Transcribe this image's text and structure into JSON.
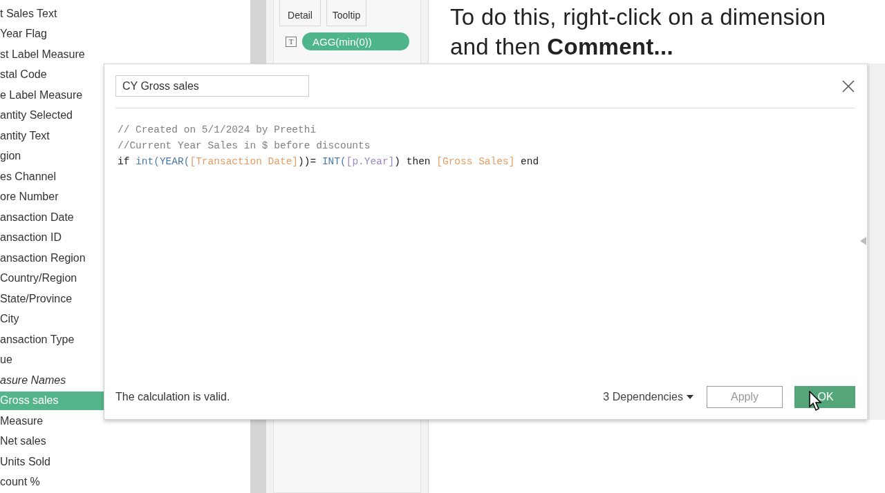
{
  "fields": [
    {
      "label": "t Sales Text",
      "kind": "field",
      "selected": false
    },
    {
      "label": "Year Flag",
      "kind": "field",
      "selected": false
    },
    {
      "label": "st Label Measure",
      "kind": "field",
      "selected": false
    },
    {
      "label": "stal Code",
      "kind": "field",
      "selected": false
    },
    {
      "label": "e Label Measure",
      "kind": "field",
      "selected": false
    },
    {
      "label": "antity  Selected",
      "kind": "field",
      "selected": false
    },
    {
      "label": "antity Text",
      "kind": "field",
      "selected": false
    },
    {
      "label": "gion",
      "kind": "field",
      "selected": false
    },
    {
      "label": "es Channel",
      "kind": "field",
      "selected": false
    },
    {
      "label": "ore Number",
      "kind": "field",
      "selected": false
    },
    {
      "label": "ansaction Date",
      "kind": "field",
      "selected": false
    },
    {
      "label": "ansaction ID",
      "kind": "field",
      "selected": false
    },
    {
      "label": "ansaction Region",
      "kind": "field",
      "selected": false
    },
    {
      "label": "Country/Region",
      "kind": "field",
      "selected": false
    },
    {
      "label": "State/Province",
      "kind": "field",
      "selected": false
    },
    {
      "label": "City",
      "kind": "field",
      "selected": false
    },
    {
      "label": "ansaction Type",
      "kind": "field",
      "selected": false
    },
    {
      "label": "ue",
      "kind": "field",
      "selected": false
    },
    {
      "label": "asure Names",
      "kind": "generated",
      "selected": false
    },
    {
      "label": "Gross sales",
      "kind": "field",
      "selected": true
    },
    {
      "label": "Measure",
      "kind": "field",
      "selected": false
    },
    {
      "label": "Net sales",
      "kind": "field",
      "selected": false
    },
    {
      "label": "Units Sold",
      "kind": "field",
      "selected": false
    },
    {
      "label": "count %",
      "kind": "field",
      "selected": false
    }
  ],
  "marks_card": {
    "buttons": [
      "Detail",
      "Tooltip"
    ],
    "pill": {
      "icon": "T",
      "label": "AGG(min(0))"
    }
  },
  "hint": {
    "lines": [
      "To do this, right-click on a dimension",
      "and then **Comment...**"
    ]
  },
  "dialog": {
    "name": "CY Gross sales",
    "code": [
      [
        {
          "kind": "comment",
          "text": "// Created on 5/1/2024 by Preethi"
        }
      ],
      [
        {
          "kind": "comment",
          "text": "//Current Year Sales in $ before discounts"
        }
      ],
      [
        {
          "kind": "keyword",
          "text": "if "
        },
        {
          "kind": "function",
          "text": "int(YEAR("
        },
        {
          "kind": "field",
          "text": "[Transaction Date]"
        },
        {
          "kind": "plain",
          "text": "))= "
        },
        {
          "kind": "function",
          "text": "INT("
        },
        {
          "kind": "parameter",
          "text": "[p.Year]"
        },
        {
          "kind": "plain",
          "text": ") then "
        },
        {
          "kind": "field",
          "text": "[Gross Sales]"
        },
        {
          "kind": "keyword",
          "text": " end"
        }
      ]
    ],
    "status": "The calculation is valid.",
    "dependencies": "3 Dependencies",
    "apply": {
      "label": "Apply",
      "disabled": true
    },
    "ok": {
      "label": "OK"
    }
  }
}
